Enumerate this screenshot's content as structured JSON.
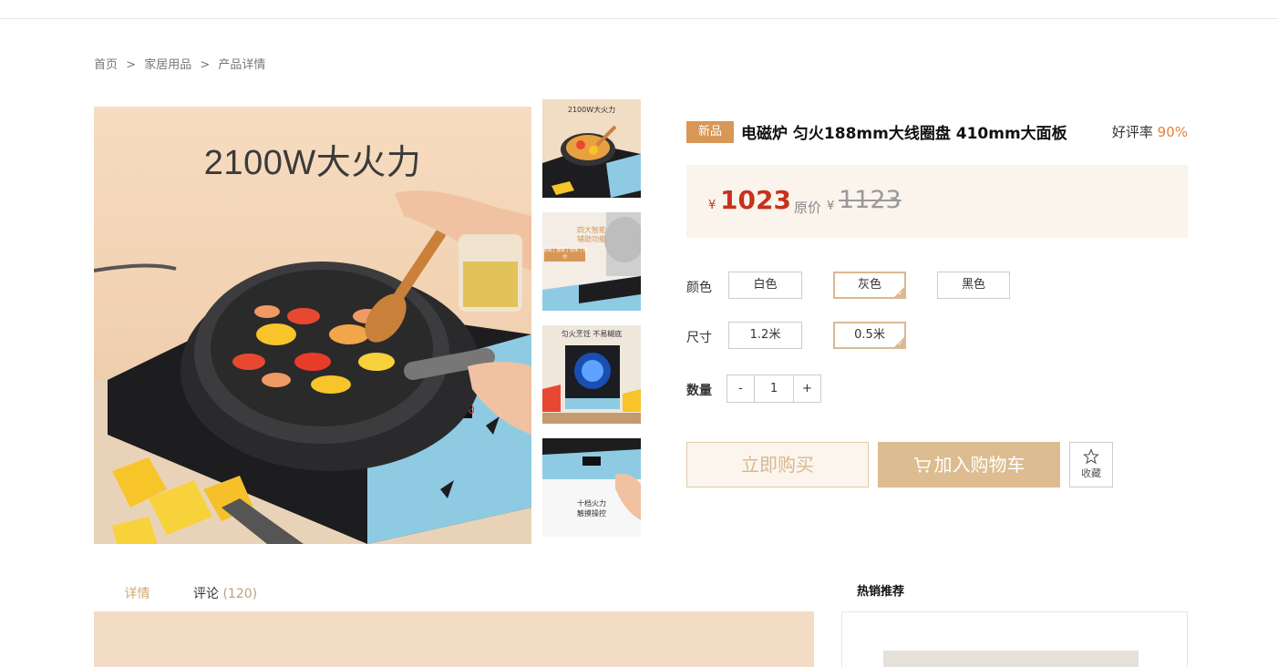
{
  "breadcrumb": {
    "home": "首页",
    "sep1": ">",
    "category": "家居用品",
    "sep2": ">",
    "current": "产品详情"
  },
  "gallery": {
    "main_headline": "2100W大火力",
    "thumbs": [
      {
        "caption": "2100W大火力"
      },
      {
        "caption": "四大智能",
        "caption2": "辅助功能",
        "caption3": "蒸炖 | 煲粥 | 烧水 | 爆炒"
      },
      {
        "caption": "匀火烹饪 不易糊底"
      },
      {
        "caption": "十档火力",
        "caption2": "触摸操控"
      }
    ]
  },
  "product": {
    "badge": "新品",
    "title": "电磁炉 匀火188mm大线圈盘 410mm大面板",
    "rating_label": "好评率",
    "rating_value": "90%",
    "currency": "¥",
    "price": "1023",
    "orig_label": "原价",
    "orig_currency": "¥",
    "orig_price": "1123"
  },
  "options": {
    "color_label": "颜色",
    "colors": [
      "白色",
      "灰色",
      "黑色"
    ],
    "selected_color": "灰色",
    "size_label": "尺寸",
    "sizes": [
      "1.2米",
      "0.5米"
    ],
    "selected_size": "0.5米",
    "qty_label": "数量",
    "qty_minus": "-",
    "qty_value": "1",
    "qty_plus": "+"
  },
  "actions": {
    "buy_now": "立即购买",
    "add_cart": "加入购物车",
    "favorite": "收藏"
  },
  "tabs": {
    "detail": "详情",
    "review": "评论",
    "review_count": "(120)"
  },
  "hot": {
    "title": "热销推荐"
  },
  "colors": {
    "accent": "#d9b990",
    "price_red": "#c8311f",
    "badge": "#d89757",
    "rating": "#e2823a"
  }
}
